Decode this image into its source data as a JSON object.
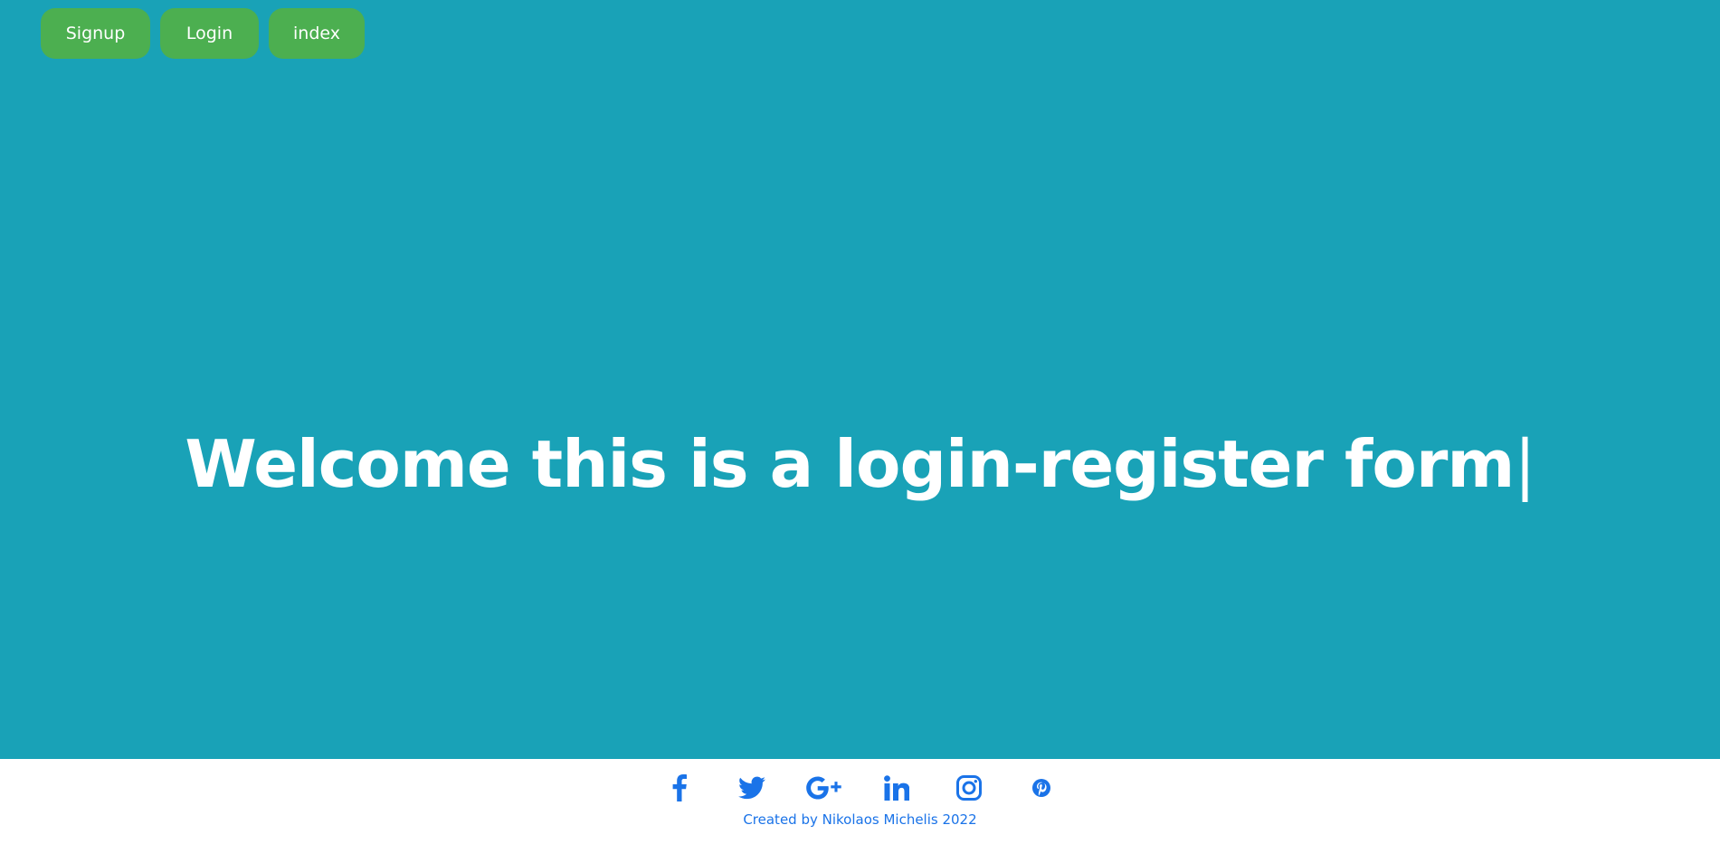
{
  "nav": {
    "buttons": [
      {
        "label": "Signup"
      },
      {
        "label": "Login"
      },
      {
        "label": "index"
      }
    ]
  },
  "hero": {
    "headline": "Welcome this is a login-register form",
    "caret": "|"
  },
  "footer": {
    "social_icons": [
      "facebook-icon",
      "twitter-icon",
      "google-plus-icon",
      "linkedin-icon",
      "instagram-icon",
      "pinterest-icon"
    ],
    "credit": "Created by Nikolaos Michelis 2022"
  },
  "colors": {
    "hero_background": "#19a2b7",
    "button_background": "#4caf50",
    "button_text": "#ffffff",
    "footer_background": "#ffffff",
    "accent_blue": "#1a73e8"
  }
}
